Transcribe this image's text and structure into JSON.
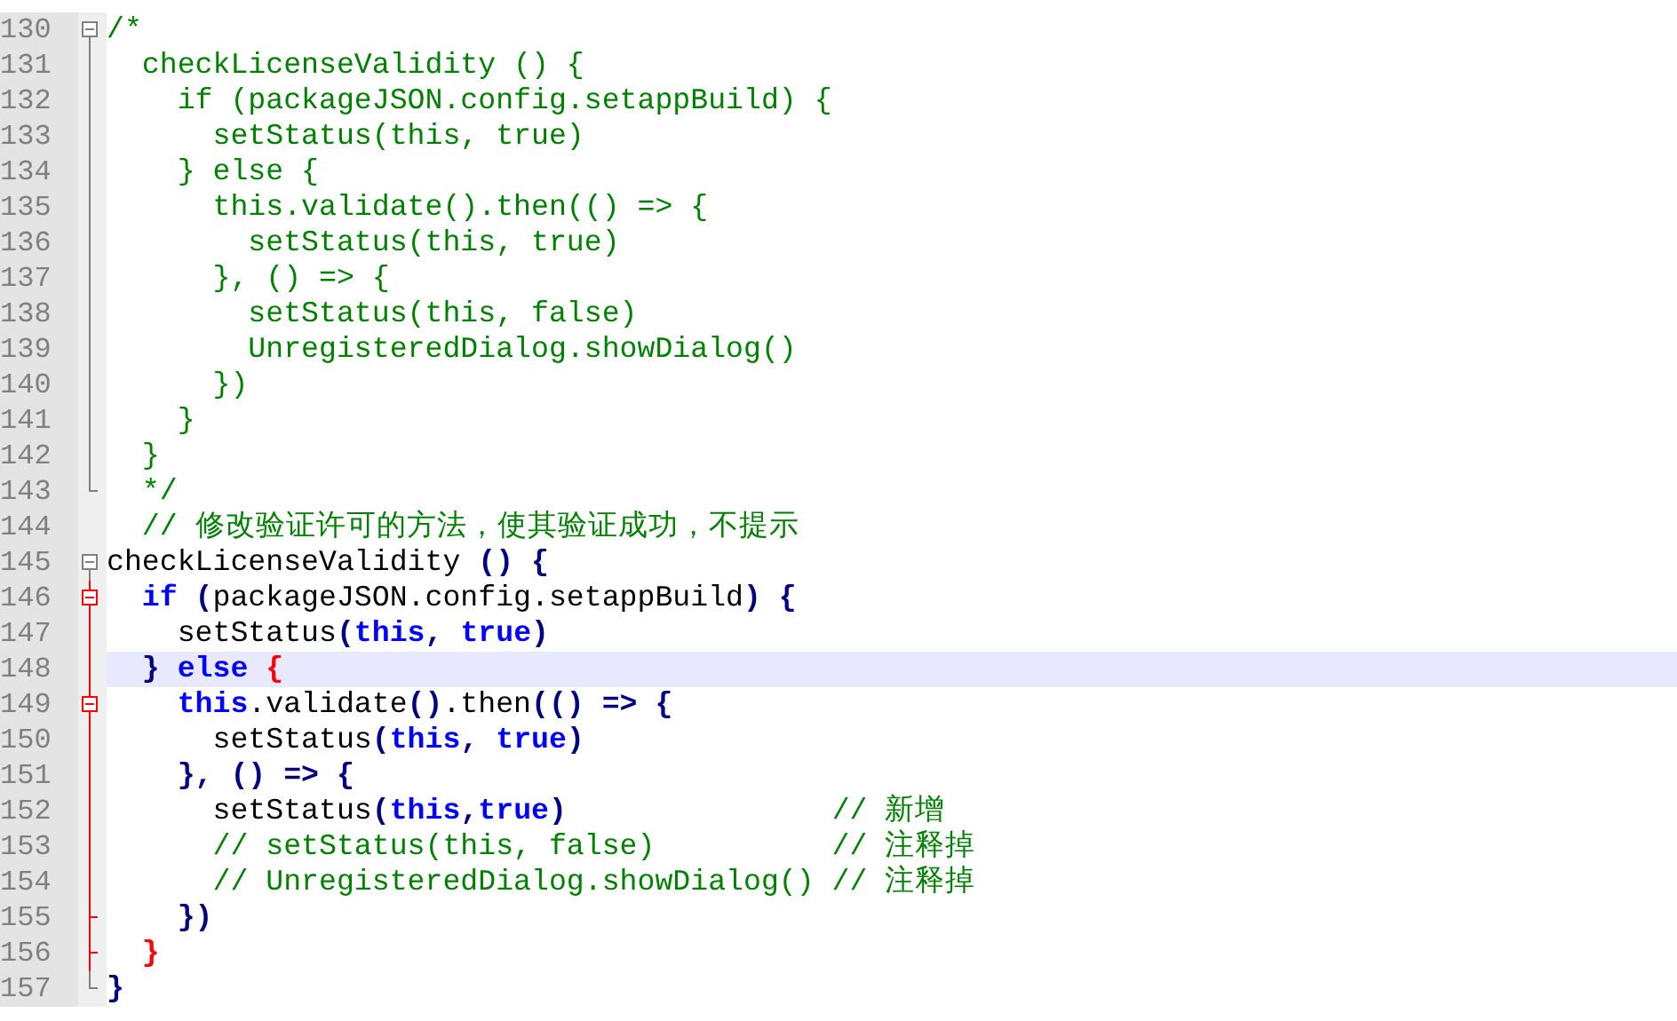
{
  "editor": {
    "lines": [
      {
        "number": "130",
        "fold_toggle": true,
        "in_fold": false,
        "fold_end": false,
        "changed": false,
        "current": false,
        "tokens": [
          {
            "kind": "comment",
            "text": "/*"
          }
        ]
      },
      {
        "number": "131",
        "fold_toggle": false,
        "in_fold": true,
        "fold_end": false,
        "changed": false,
        "current": false,
        "tokens": [
          {
            "kind": "comment",
            "text": "  checkLicenseValidity () {"
          }
        ]
      },
      {
        "number": "132",
        "fold_toggle": false,
        "in_fold": true,
        "fold_end": false,
        "changed": false,
        "current": false,
        "tokens": [
          {
            "kind": "comment",
            "text": "    if (packageJSON.config.setappBuild) {"
          }
        ]
      },
      {
        "number": "133",
        "fold_toggle": false,
        "in_fold": true,
        "fold_end": false,
        "changed": false,
        "current": false,
        "tokens": [
          {
            "kind": "comment",
            "text": "      setStatus(this, true)"
          }
        ]
      },
      {
        "number": "134",
        "fold_toggle": false,
        "in_fold": true,
        "fold_end": false,
        "changed": false,
        "current": false,
        "tokens": [
          {
            "kind": "comment",
            "text": "    } else {"
          }
        ]
      },
      {
        "number": "135",
        "fold_toggle": false,
        "in_fold": true,
        "fold_end": false,
        "changed": false,
        "current": false,
        "tokens": [
          {
            "kind": "comment",
            "text": "      this.validate().then(() => {"
          }
        ]
      },
      {
        "number": "136",
        "fold_toggle": false,
        "in_fold": true,
        "fold_end": false,
        "changed": false,
        "current": false,
        "tokens": [
          {
            "kind": "comment",
            "text": "        setStatus(this, true)"
          }
        ]
      },
      {
        "number": "137",
        "fold_toggle": false,
        "in_fold": true,
        "fold_end": false,
        "changed": false,
        "current": false,
        "tokens": [
          {
            "kind": "comment",
            "text": "      }, () => {"
          }
        ]
      },
      {
        "number": "138",
        "fold_toggle": false,
        "in_fold": true,
        "fold_end": false,
        "changed": false,
        "current": false,
        "tokens": [
          {
            "kind": "comment",
            "text": "        setStatus(this, false)"
          }
        ]
      },
      {
        "number": "139",
        "fold_toggle": false,
        "in_fold": true,
        "fold_end": false,
        "changed": false,
        "current": false,
        "tokens": [
          {
            "kind": "comment",
            "text": "        UnregisteredDialog.showDialog()"
          }
        ]
      },
      {
        "number": "140",
        "fold_toggle": false,
        "in_fold": true,
        "fold_end": false,
        "changed": false,
        "current": false,
        "tokens": [
          {
            "kind": "comment",
            "text": "      })"
          }
        ]
      },
      {
        "number": "141",
        "fold_toggle": false,
        "in_fold": true,
        "fold_end": false,
        "changed": false,
        "current": false,
        "tokens": [
          {
            "kind": "comment",
            "text": "    }"
          }
        ]
      },
      {
        "number": "142",
        "fold_toggle": false,
        "in_fold": true,
        "fold_end": false,
        "changed": false,
        "current": false,
        "tokens": [
          {
            "kind": "comment",
            "text": "  }"
          }
        ]
      },
      {
        "number": "143",
        "fold_toggle": false,
        "in_fold": false,
        "fold_end": true,
        "changed": false,
        "current": false,
        "tokens": [
          {
            "kind": "comment",
            "text": "  */"
          }
        ]
      },
      {
        "number": "144",
        "fold_toggle": false,
        "in_fold": false,
        "fold_end": false,
        "changed": false,
        "current": false,
        "tokens": [
          {
            "kind": "comment",
            "text": "  // 修改验证许可的方法，使其验证成功，不提示"
          }
        ]
      },
      {
        "number": "145",
        "fold_toggle": true,
        "in_fold": false,
        "fold_end": false,
        "changed": false,
        "current": false,
        "tokens": [
          {
            "kind": "plain",
            "text": "checkLicenseValidity"
          },
          {
            "kind": "op",
            "text": " () {"
          }
        ]
      },
      {
        "number": "146",
        "fold_toggle": true,
        "in_fold": false,
        "fold_end": false,
        "changed": true,
        "current": false,
        "tokens": [
          {
            "kind": "keyword",
            "text": "  if"
          },
          {
            "kind": "op",
            "text": " ("
          },
          {
            "kind": "plain",
            "text": "packageJSON.config.setappBuild"
          },
          {
            "kind": "op",
            "text": ") {"
          }
        ]
      },
      {
        "number": "147",
        "fold_toggle": false,
        "in_fold": true,
        "fold_end": false,
        "changed": true,
        "current": false,
        "tokens": [
          {
            "kind": "plain",
            "text": "    setStatus"
          },
          {
            "kind": "op",
            "text": "("
          },
          {
            "kind": "keyword",
            "text": "this"
          },
          {
            "kind": "op",
            "text": ","
          },
          {
            "kind": "keyword",
            "text": " true"
          },
          {
            "kind": "op",
            "text": ")"
          }
        ]
      },
      {
        "number": "148",
        "fold_toggle": false,
        "in_fold": true,
        "fold_end": false,
        "changed": true,
        "current": true,
        "tokens": [
          {
            "kind": "op",
            "text": "  }"
          },
          {
            "kind": "keyword",
            "text": " else"
          },
          {
            "kind": "brace-match",
            "text": " {"
          }
        ]
      },
      {
        "number": "149",
        "fold_toggle": true,
        "in_fold": false,
        "fold_end": false,
        "changed": true,
        "current": false,
        "tokens": [
          {
            "kind": "keyword",
            "text": "    this"
          },
          {
            "kind": "plain",
            "text": ".validate"
          },
          {
            "kind": "op",
            "text": "()"
          },
          {
            "kind": "plain",
            "text": ".then"
          },
          {
            "kind": "op",
            "text": "(() => {"
          }
        ]
      },
      {
        "number": "150",
        "fold_toggle": false,
        "in_fold": true,
        "fold_end": false,
        "changed": true,
        "current": false,
        "tokens": [
          {
            "kind": "plain",
            "text": "      setStatus"
          },
          {
            "kind": "op",
            "text": "("
          },
          {
            "kind": "keyword",
            "text": "this"
          },
          {
            "kind": "op",
            "text": ","
          },
          {
            "kind": "keyword",
            "text": " true"
          },
          {
            "kind": "op",
            "text": ")"
          }
        ]
      },
      {
        "number": "151",
        "fold_toggle": false,
        "in_fold": true,
        "fold_end": false,
        "changed": true,
        "current": false,
        "tokens": [
          {
            "kind": "op",
            "text": "    }, () => {"
          }
        ]
      },
      {
        "number": "152",
        "fold_toggle": false,
        "in_fold": true,
        "fold_end": false,
        "changed": true,
        "current": false,
        "tokens": [
          {
            "kind": "plain",
            "text": "      setStatus"
          },
          {
            "kind": "op",
            "text": "("
          },
          {
            "kind": "keyword",
            "text": "this"
          },
          {
            "kind": "op",
            "text": ","
          },
          {
            "kind": "keyword",
            "text": "true"
          },
          {
            "kind": "op",
            "text": ")"
          },
          {
            "kind": "comment",
            "text": "               // 新增"
          }
        ]
      },
      {
        "number": "153",
        "fold_toggle": false,
        "in_fold": true,
        "fold_end": false,
        "changed": true,
        "current": false,
        "tokens": [
          {
            "kind": "comment",
            "text": "      // setStatus(this, false)          // 注释掉"
          }
        ]
      },
      {
        "number": "154",
        "fold_toggle": false,
        "in_fold": true,
        "fold_end": false,
        "changed": true,
        "current": false,
        "tokens": [
          {
            "kind": "comment",
            "text": "      // UnregisteredDialog.showDialog() // 注释掉"
          }
        ]
      },
      {
        "number": "155",
        "fold_toggle": false,
        "in_fold": false,
        "fold_end": true,
        "changed": true,
        "current": false,
        "tokens": [
          {
            "kind": "op",
            "text": "    })"
          }
        ]
      },
      {
        "number": "156",
        "fold_toggle": false,
        "in_fold": false,
        "fold_end": true,
        "changed": true,
        "current": false,
        "tokens": [
          {
            "kind": "brace-match",
            "text": "  }"
          }
        ]
      },
      {
        "number": "157",
        "fold_toggle": false,
        "in_fold": false,
        "fold_end": true,
        "changed": false,
        "current": false,
        "tokens": [
          {
            "kind": "op",
            "text": "}"
          }
        ]
      }
    ]
  }
}
